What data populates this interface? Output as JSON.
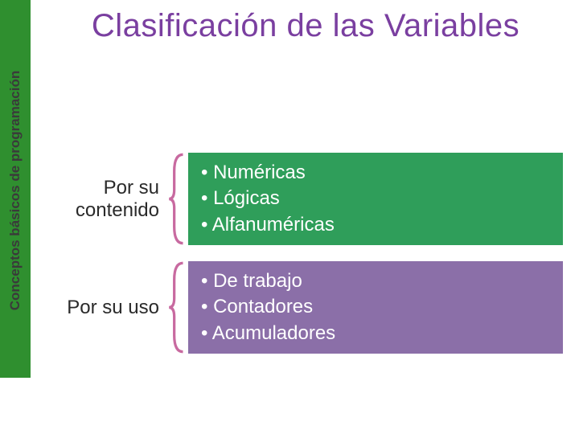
{
  "sidebar": {
    "label": "Conceptos básicos de programación"
  },
  "title": "Clasificación de las Variables",
  "colors": {
    "accent_purple": "#7a3fa0",
    "sidebar_green": "#2f8f2f",
    "box_green": "#2f9e5a",
    "box_purple": "#8b6fa8",
    "brace_pink": "#c86aa0"
  },
  "rows": [
    {
      "label": "Por su contenido",
      "box_color": "green",
      "items": [
        "Numéricas",
        "Lógicas",
        "Alfanuméricas"
      ]
    },
    {
      "label": "Por su uso",
      "box_color": "purple",
      "items": [
        "De trabajo",
        "Contadores",
        "Acumuladores"
      ]
    }
  ]
}
